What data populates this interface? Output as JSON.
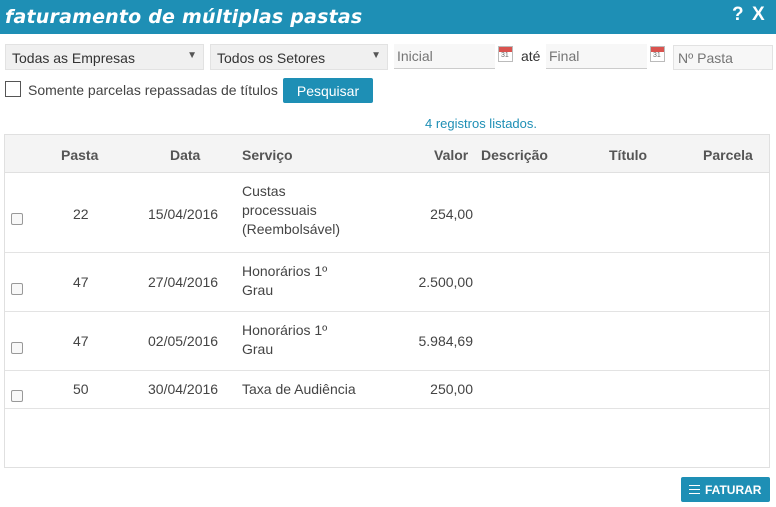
{
  "window": {
    "title": "faturamento de múltiplas pastas",
    "help_label": "?",
    "close_label": "X"
  },
  "filters": {
    "empresa": "Todas as Empresas",
    "setor": "Todos os Setores",
    "data_inicial_placeholder": "Inicial",
    "ate_label": "até",
    "data_final_placeholder": "Final",
    "calendar_day": "31",
    "pasta_placeholder": "Nº Pasta",
    "somente_parcelas_label": "Somente parcelas repassadas de títulos",
    "pesquisar_label": "Pesquisar"
  },
  "results": {
    "count_text": "4 registros listados."
  },
  "table": {
    "headers": {
      "pasta": "Pasta",
      "data": "Data",
      "servico": "Serviço",
      "valor": "Valor",
      "descricao": "Descrição",
      "titulo": "Título",
      "parcela": "Parcela"
    },
    "rows": [
      {
        "pasta": "22",
        "data": "15/04/2016",
        "servico": [
          "Custas",
          "processuais",
          "(Reembolsável)"
        ],
        "valor": "254,00",
        "descricao": "",
        "titulo": "",
        "parcela": ""
      },
      {
        "pasta": "47",
        "data": "27/04/2016",
        "servico": [
          "Honorários 1º",
          "Grau"
        ],
        "valor": "2.500,00",
        "descricao": "",
        "titulo": "",
        "parcela": ""
      },
      {
        "pasta": "47",
        "data": "02/05/2016",
        "servico": [
          "Honorários 1º",
          "Grau"
        ],
        "valor": "5.984,69",
        "descricao": "",
        "titulo": "",
        "parcela": ""
      },
      {
        "pasta": "50",
        "data": "30/04/2016",
        "servico": [
          "Taxa de Audiência"
        ],
        "valor": "250,00",
        "descricao": "",
        "titulo": "",
        "parcela": ""
      }
    ]
  },
  "actions": {
    "faturar_label": "FATURAR"
  },
  "colors": {
    "accent": "#1e8fb5"
  }
}
